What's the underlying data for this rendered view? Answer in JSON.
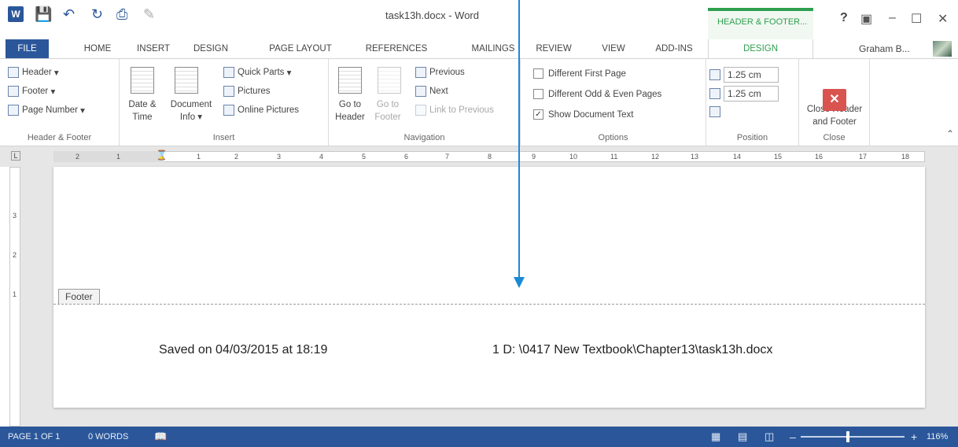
{
  "window": {
    "title": "task13h.docx - Word",
    "context_tab_title": "HEADER & FOOTER...",
    "help": "?",
    "user_name": "Graham B..."
  },
  "tabs": [
    "FILE",
    "HOME",
    "INSERT",
    "DESIGN",
    "PAGE LAYOUT",
    "REFERENCES",
    "MAILINGS",
    "REVIEW",
    "VIEW",
    "ADD-INS",
    "DESIGN"
  ],
  "ribbon": {
    "header_footer": {
      "header": "Header",
      "footer": "Footer",
      "page_number": "Page Number",
      "label": "Header & Footer"
    },
    "insert": {
      "date_time_1": "Date &",
      "date_time_2": "Time",
      "document_info_1": "Document",
      "document_info_2": "Info",
      "quick_parts": "Quick Parts",
      "pictures": "Pictures",
      "online_pictures": "Online Pictures",
      "label": "Insert"
    },
    "navigation": {
      "go_to_header_1": "Go to",
      "go_to_header_2": "Header",
      "go_to_footer_1": "Go to",
      "go_to_footer_2": "Footer",
      "previous": "Previous",
      "next": "Next",
      "link_to_previous": "Link to Previous",
      "label": "Navigation"
    },
    "options": {
      "different_first_page": "Different First Page",
      "different_odd_even": "Different Odd & Even Pages",
      "show_document_text": "Show Document Text",
      "show_document_text_checked": true,
      "label": "Options"
    },
    "position": {
      "header_from_top": "1.25 cm",
      "footer_from_bottom": "1.25 cm",
      "label": "Position"
    },
    "close": {
      "close_1": "Close Header",
      "close_2": "and Footer",
      "label": "Close"
    }
  },
  "ruler": {
    "marks": [
      "2",
      "1",
      "1",
      "2",
      "3",
      "4",
      "5",
      "6",
      "7",
      "8",
      "9",
      "10",
      "11",
      "12",
      "13",
      "14",
      "15",
      "16",
      "17",
      "18"
    ]
  },
  "vruler": {
    "marks": [
      "3",
      "2",
      "1"
    ]
  },
  "document": {
    "footer_tab": "Footer",
    "footer_left": "Saved on 04/03/2015 at 18:19",
    "footer_right": "1  D: \\0417 New Textbook\\Chapter13\\task13h.docx"
  },
  "statusbar": {
    "page": "PAGE 1 OF 1",
    "words": "0 WORDS",
    "zoom": "116%"
  },
  "colors": {
    "accent": "#2b579a",
    "context_green": "#2e9f4f",
    "arrow": "#1a8ad6"
  }
}
